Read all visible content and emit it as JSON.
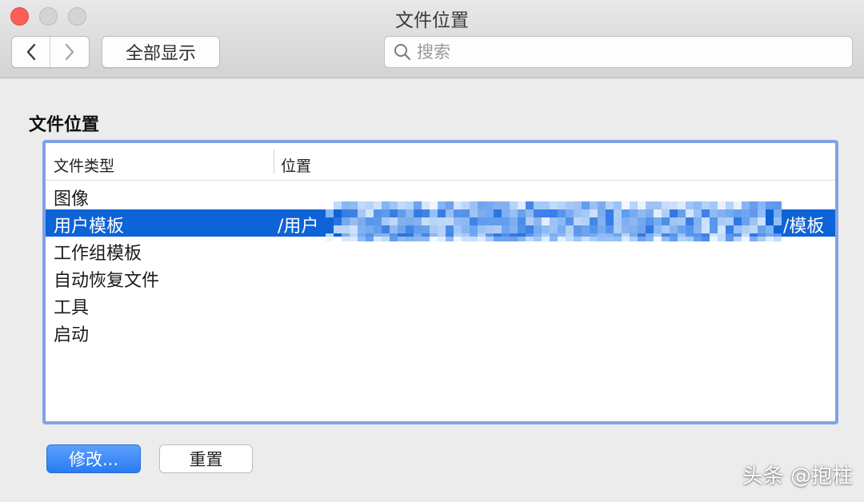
{
  "window": {
    "title": "文件位置"
  },
  "toolbar": {
    "show_all_label": "全部显示",
    "search_placeholder": "搜索"
  },
  "section": {
    "title": "文件位置"
  },
  "table": {
    "headers": {
      "type": "文件类型",
      "location": "位置"
    },
    "rows": [
      {
        "type": "图像",
        "location": ""
      },
      {
        "type": "用户模板",
        "location_prefix": "/用户",
        "location_suffix": "/模板",
        "selected": true
      },
      {
        "type": "工作组模板",
        "location": ""
      },
      {
        "type": "自动恢复文件",
        "location": ""
      },
      {
        "type": "工具",
        "location": ""
      },
      {
        "type": "启动",
        "location": ""
      }
    ]
  },
  "buttons": {
    "modify_label": "修改...",
    "reset_label": "重置"
  },
  "watermark": "头条 @抱柱",
  "colors": {
    "selection": "#0e63d6",
    "table_focus_border": "#7fa3e4",
    "close_button": "#fc5f57",
    "primary_button": "#2a7af0"
  }
}
